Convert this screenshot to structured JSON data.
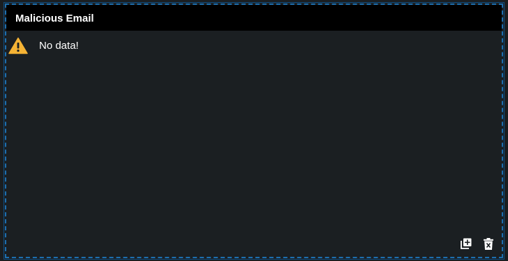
{
  "widget": {
    "title": "Malicious Email",
    "empty_message": "No data!",
    "icons": {
      "warning": "warning-triangle-icon",
      "duplicate": "add-copy-icon",
      "delete": "delete-trash-icon"
    }
  },
  "colors": {
    "background": "#1b1f22",
    "header": "#000000",
    "border_accent": "#1d6fb0",
    "warning": "#f5b335",
    "text": "#ffffff"
  }
}
